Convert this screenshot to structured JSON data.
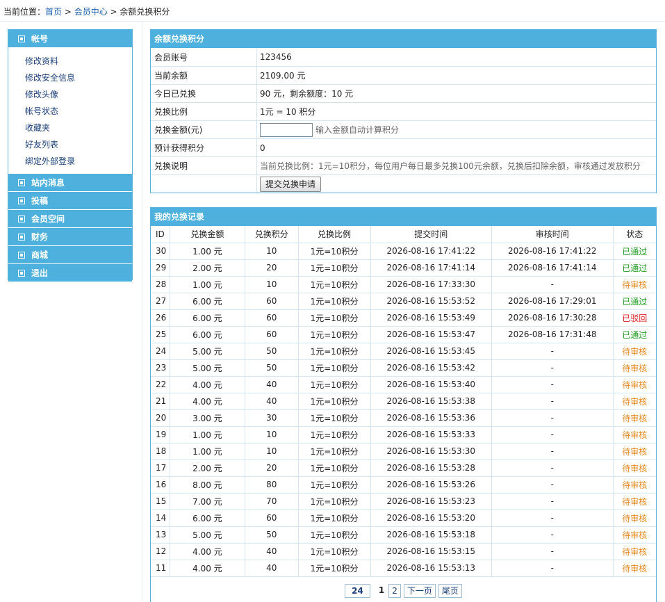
{
  "breadcrumb": {
    "prefix": "当前位置：",
    "home": "首页",
    "sep1": " > ",
    "member_center": "会员中心",
    "sep2": " > ",
    "current": "余额兑换积分"
  },
  "sidebar": {
    "account": {
      "title": "帐号",
      "items": [
        "修改资料",
        "修改安全信息",
        "修改头像",
        "帐号状态",
        "收藏夹",
        "好友列表",
        "绑定外部登录"
      ]
    },
    "sections": [
      "站内消息",
      "投稿",
      "会员空间",
      "财务",
      "商城",
      "退出"
    ]
  },
  "form": {
    "title": "余额兑换积分",
    "rows": {
      "account": {
        "label": "会员账号",
        "value": "123456"
      },
      "balance": {
        "label": "当前余额",
        "value": "2109.00 元"
      },
      "today": {
        "label": "今日已兑换",
        "value": "90 元，剩余额度：10 元"
      },
      "ratio": {
        "label": "兑换比例",
        "value": "1元 = 10 积分"
      },
      "amount": {
        "label": "兑换金额(元)",
        "value": "",
        "hint": "输入金额自动计算积分"
      },
      "estimate": {
        "label": "预计获得积分",
        "value": "0"
      },
      "note": {
        "label": "兑换说明",
        "value": "当前兑换比例：1元=10积分，每位用户每日最多兑换100元余额，兑换后扣除余额，审核通过发放积分"
      }
    },
    "submit_label": "提交兑换申请"
  },
  "records": {
    "title": "我的兑换记录",
    "headers": [
      "ID",
      "兑换金额",
      "兑换积分",
      "兑换比例",
      "提交时间",
      "审核时间",
      "状态"
    ],
    "rows": [
      [
        "30",
        "1.00 元",
        "10",
        "1元=10积分",
        "2026-08-16 17:41:22",
        "2026-08-16 17:41:22",
        "已通过"
      ],
      [
        "29",
        "2.00 元",
        "20",
        "1元=10积分",
        "2026-08-16 17:41:14",
        "2026-08-16 17:41:14",
        "已通过"
      ],
      [
        "28",
        "1.00 元",
        "10",
        "1元=10积分",
        "2026-08-16 17:33:30",
        "-",
        "待审核"
      ],
      [
        "27",
        "6.00 元",
        "60",
        "1元=10积分",
        "2026-08-16 15:53:52",
        "2026-08-16 17:29:01",
        "已通过"
      ],
      [
        "26",
        "6.00 元",
        "60",
        "1元=10积分",
        "2026-08-16 15:53:49",
        "2026-08-16 17:30:28",
        "已驳回"
      ],
      [
        "25",
        "6.00 元",
        "60",
        "1元=10积分",
        "2026-08-16 15:53:47",
        "2026-08-16 17:31:48",
        "已通过"
      ],
      [
        "24",
        "5.00 元",
        "50",
        "1元=10积分",
        "2026-08-16 15:53:45",
        "-",
        "待审核"
      ],
      [
        "23",
        "5.00 元",
        "50",
        "1元=10积分",
        "2026-08-16 15:53:42",
        "-",
        "待审核"
      ],
      [
        "22",
        "4.00 元",
        "40",
        "1元=10积分",
        "2026-08-16 15:53:40",
        "-",
        "待审核"
      ],
      [
        "21",
        "4.00 元",
        "40",
        "1元=10积分",
        "2026-08-16 15:53:38",
        "-",
        "待审核"
      ],
      [
        "20",
        "3.00 元",
        "30",
        "1元=10积分",
        "2026-08-16 15:53:36",
        "-",
        "待审核"
      ],
      [
        "19",
        "1.00 元",
        "10",
        "1元=10积分",
        "2026-08-16 15:53:33",
        "-",
        "待审核"
      ],
      [
        "18",
        "1.00 元",
        "10",
        "1元=10积分",
        "2026-08-16 15:53:30",
        "-",
        "待审核"
      ],
      [
        "17",
        "2.00 元",
        "20",
        "1元=10积分",
        "2026-08-16 15:53:28",
        "-",
        "待审核"
      ],
      [
        "16",
        "8.00 元",
        "80",
        "1元=10积分",
        "2026-08-16 15:53:26",
        "-",
        "待审核"
      ],
      [
        "15",
        "7.00 元",
        "70",
        "1元=10积分",
        "2026-08-16 15:53:23",
        "-",
        "待审核"
      ],
      [
        "14",
        "6.00 元",
        "60",
        "1元=10积分",
        "2026-08-16 15:53:20",
        "-",
        "待审核"
      ],
      [
        "13",
        "5.00 元",
        "50",
        "1元=10积分",
        "2026-08-16 15:53:18",
        "-",
        "待审核"
      ],
      [
        "12",
        "4.00 元",
        "40",
        "1元=10积分",
        "2026-08-16 15:53:15",
        "-",
        "待审核"
      ],
      [
        "11",
        "4.00 元",
        "40",
        "1元=10积分",
        "2026-08-16 15:53:13",
        "-",
        "待审核"
      ]
    ],
    "status_colors": {
      "已通过": "#1a9a1a",
      "待审核": "#e6871a",
      "已驳回": "#e02020"
    }
  },
  "pager": {
    "total": "24",
    "current": "1",
    "page2": "2",
    "next": "下一页",
    "last": "尾页"
  },
  "colors": {
    "header_blue": "#4eb0dc",
    "border_blue": "#59b4dd",
    "link": "#1a5fb0"
  }
}
